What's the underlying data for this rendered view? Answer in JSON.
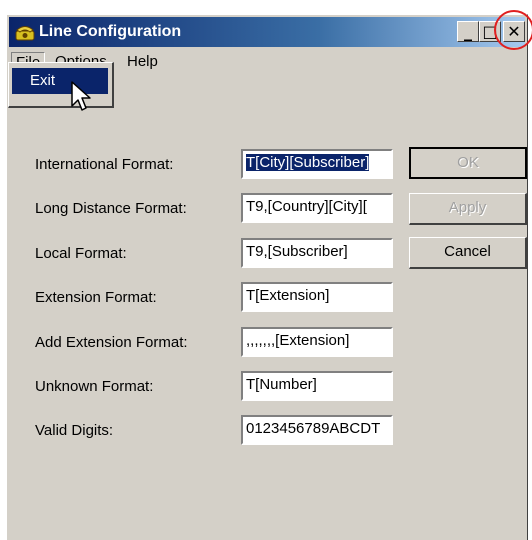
{
  "window": {
    "title": "Line Configuration",
    "minimize_glyph": "_",
    "maximize_glyph": "□",
    "close_glyph": "✕"
  },
  "menu": {
    "items": [
      {
        "label": "File"
      },
      {
        "label": "Options"
      },
      {
        "label": "Help"
      }
    ],
    "file_dropdown": {
      "items": [
        {
          "label": "Exit",
          "highlighted": true
        }
      ]
    }
  },
  "form": {
    "rows": [
      {
        "label": "International Format:",
        "value": "T[City][Subscriber]",
        "selected": true
      },
      {
        "label": "Long Distance Format:",
        "value": "T9,[Country][City][",
        "selected": false
      },
      {
        "label": "Local Format:",
        "value": "T9,[Subscriber]",
        "selected": false
      },
      {
        "label": "Extension Format:",
        "value": "T[Extension]",
        "selected": false
      },
      {
        "label": "Add Extension Format:",
        "value": ",,,,,,,[Extension]",
        "selected": false
      },
      {
        "label": "Unknown Format:",
        "value": "T[Number]",
        "selected": false
      },
      {
        "label": "Valid Digits:",
        "value": "0123456789ABCDT",
        "selected": false
      }
    ]
  },
  "buttons": {
    "ok": {
      "label": "OK",
      "enabled": false
    },
    "apply": {
      "label": "Apply",
      "enabled": false
    },
    "cancel": {
      "label": "Cancel",
      "enabled": true
    }
  },
  "icons": {
    "title": "phone-icon",
    "cursor": "mouse-pointer-icon"
  },
  "colors": {
    "title_bar_start": "#0a246a",
    "title_bar_end": "#a6caf0",
    "highlight": "#0a246a",
    "annotation_circle": "#e02020",
    "window_face": "#d4d0c8"
  }
}
